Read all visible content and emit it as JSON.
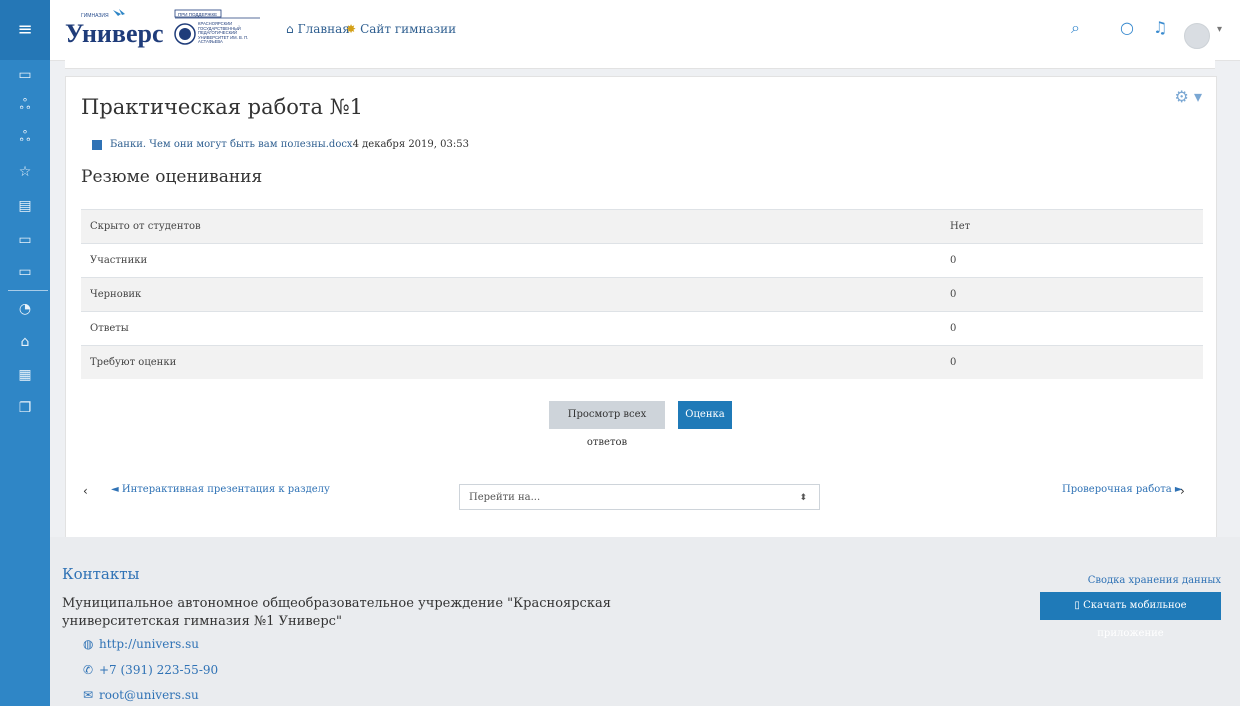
{
  "header": {
    "logo_small_top": "ГИМНАЗИЯ",
    "logo_name": "Универс",
    "logo_support": "ПРИ ПОДДЕРЖКЕ",
    "logo_university": "КРАСНОЯРСКИЙ ГОСУДАРСТВЕННЫЙ ПЕДАГОГИЧЕСКИЙ УНИВЕРСИТЕТ ИМ. В. П. АСТАФЬЕВА",
    "nav_home": "Главная",
    "nav_site": "Сайт гимназии",
    "icons": [
      "search-icon",
      "chat-icon",
      "bell-icon",
      "user-icon",
      "caret-down-icon"
    ]
  },
  "sidebar": {
    "items": [
      "menu-icon",
      "folder-icon",
      "users-icon",
      "users-icon",
      "star-icon",
      "book-icon",
      "folder-icon",
      "folder-icon",
      "dashboard-icon",
      "home-icon",
      "calendar-icon",
      "files-icon"
    ]
  },
  "page": {
    "title": "Практическая работа №1",
    "file_link": "Банки. Чем они могут быть вам полезны.docx",
    "file_date": "4 декабря 2019, 03:53",
    "section_title": "Резюме оценивания",
    "rows": [
      {
        "label": "Скрыто от студентов",
        "value": "Нет"
      },
      {
        "label": "Участники",
        "value": "0"
      },
      {
        "label": "Черновик",
        "value": "0"
      },
      {
        "label": "Ответы",
        "value": "0"
      },
      {
        "label": "Требуют оценки",
        "value": "0"
      }
    ],
    "view_all_button": "Просмотр всех ответов",
    "grade_button": "Оценка",
    "prev_arrow": "‹",
    "prev_link": "◄ Интерактивная презентация к разделу",
    "jump_placeholder": "Перейти на...",
    "next_link": "Проверочная работа ►",
    "next_arrow": "›"
  },
  "footer": {
    "title": "Контакты",
    "org": "Муниципальное автономное общеобразовательное учреждение \"Красноярская университетская гимназия №1 Универс\"",
    "website": "http://univers.su",
    "phone": "+7 (391) 223-55-90",
    "email": "root@univers.su",
    "data_summary": "Сводка хранения данных",
    "app_button": "Скачать мобильное приложение"
  },
  "colors": {
    "accent": "#1f7ab8",
    "sidebar": "#2f86c6"
  }
}
